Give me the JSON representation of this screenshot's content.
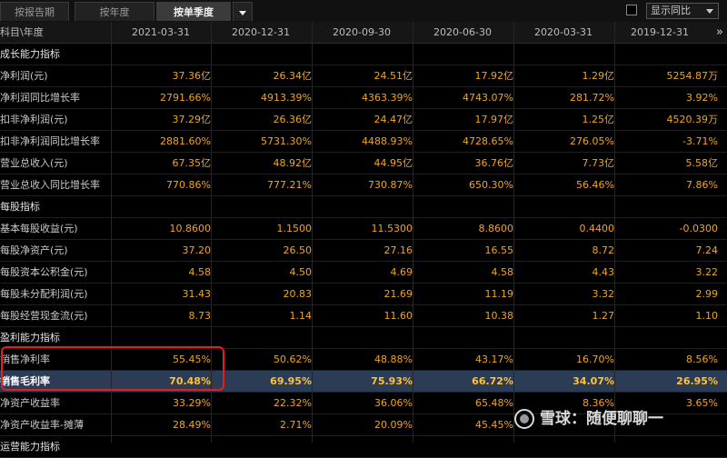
{
  "tabs": [
    {
      "label": "按报告期"
    },
    {
      "label": "按年度"
    },
    {
      "label": "按单季度"
    }
  ],
  "toolbar": {
    "yoy_option": "显示同比",
    "more_label": "»"
  },
  "table": {
    "header_label": "科目\\年度",
    "dates": [
      "2021-03-31",
      "2020-12-31",
      "2020-09-30",
      "2020-06-30",
      "2020-03-31",
      "2019-12-31"
    ],
    "rows": [
      {
        "label": "成长能力指标",
        "section": true,
        "values": [
          "",
          "",
          "",
          "",
          "",
          ""
        ]
      },
      {
        "label": "净利润(元)",
        "values": [
          "37.36亿",
          "26.34亿",
          "24.51亿",
          "17.92亿",
          "1.29亿",
          "5254.87万"
        ]
      },
      {
        "label": "净利润同比增长率",
        "values": [
          "2791.66%",
          "4913.39%",
          "4363.39%",
          "4743.07%",
          "281.72%",
          "3.92%"
        ]
      },
      {
        "label": "扣非净利润(元)",
        "values": [
          "37.29亿",
          "26.36亿",
          "24.47亿",
          "17.97亿",
          "1.25亿",
          "4520.39万"
        ]
      },
      {
        "label": "扣非净利润同比增长率",
        "values": [
          "2881.60%",
          "5731.30%",
          "4488.93%",
          "4728.65%",
          "276.05%",
          "-3.71%"
        ]
      },
      {
        "label": "营业总收入(元)",
        "values": [
          "67.35亿",
          "48.92亿",
          "44.95亿",
          "36.76亿",
          "7.73亿",
          "5.58亿"
        ]
      },
      {
        "label": "营业总收入同比增长率",
        "values": [
          "770.86%",
          "777.21%",
          "730.87%",
          "650.30%",
          "56.46%",
          "7.86%"
        ]
      },
      {
        "label": "每股指标",
        "section": true,
        "values": [
          "",
          "",
          "",
          "",
          "",
          ""
        ]
      },
      {
        "label": "基本每股收益(元)",
        "values": [
          "10.8600",
          "1.1500",
          "11.5300",
          "8.8600",
          "0.4400",
          "-0.0300"
        ]
      },
      {
        "label": "每股净资产(元)",
        "values": [
          "37.20",
          "26.50",
          "27.16",
          "16.55",
          "8.72",
          "7.24"
        ]
      },
      {
        "label": "每股资本公积金(元)",
        "values": [
          "4.58",
          "4.50",
          "4.69",
          "4.58",
          "4.43",
          "3.22"
        ]
      },
      {
        "label": "每股未分配利润(元)",
        "values": [
          "31.43",
          "20.83",
          "21.69",
          "11.19",
          "3.32",
          "2.99"
        ]
      },
      {
        "label": "每股经营现金流(元)",
        "values": [
          "8.73",
          "1.14",
          "11.60",
          "10.38",
          "1.27",
          "1.10"
        ]
      },
      {
        "label": "盈利能力指标",
        "section": true,
        "values": [
          "",
          "",
          "",
          "",
          "",
          ""
        ]
      },
      {
        "label": "销售净利率",
        "values": [
          "55.45%",
          "50.62%",
          "48.88%",
          "43.17%",
          "16.70%",
          "8.56%"
        ]
      },
      {
        "label": "销售毛利率",
        "selected": true,
        "values": [
          "70.48%",
          "69.95%",
          "75.93%",
          "66.72%",
          "34.07%",
          "26.95%"
        ]
      },
      {
        "label": "净资产收益率",
        "values": [
          "33.29%",
          "22.32%",
          "36.06%",
          "65.48%",
          "8.36%",
          "3.65%"
        ]
      },
      {
        "label": "净资产收益率-摊薄",
        "values": [
          "28.49%",
          "2.71%",
          "20.09%",
          "45.45%",
          "",
          ""
        ]
      },
      {
        "label": "运营能力指标",
        "section": true,
        "values": [
          "",
          "",
          "",
          "",
          "",
          ""
        ]
      }
    ]
  },
  "watermark": {
    "text": "雪球：随便聊聊一"
  }
}
